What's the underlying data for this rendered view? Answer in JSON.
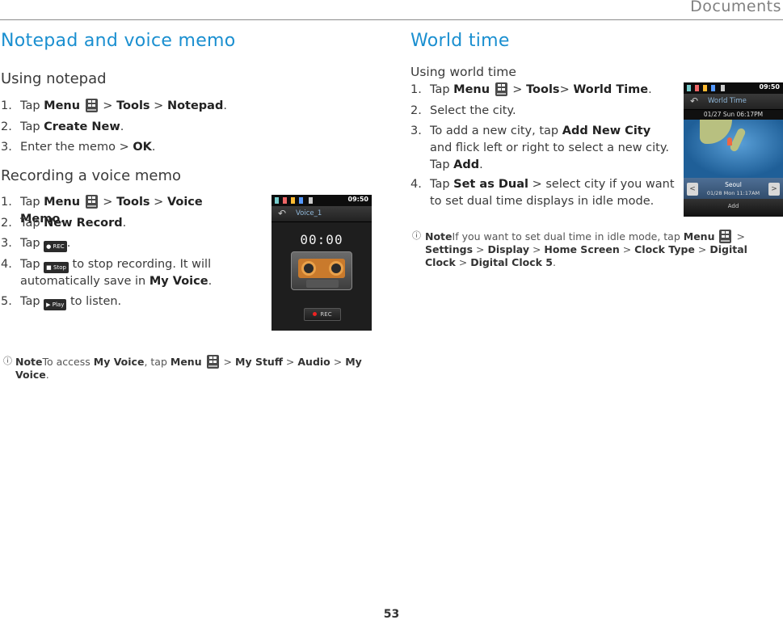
{
  "header": {
    "section": "Documents"
  },
  "left": {
    "title": "Notepad and voice memo",
    "notepad": {
      "heading": "Using notepad",
      "steps": [
        {
          "num": "1.",
          "pre": "Tap ",
          "b1": "Menu",
          "mid1": " > ",
          "b2": "Tools",
          "mid2": " > ",
          "b3": "Notepad",
          "post": "."
        },
        {
          "num": "2.",
          "pre": "Tap ",
          "b1": "Create New",
          "post": "."
        },
        {
          "num": "3.",
          "pre": "Enter the memo > ",
          "b1": "OK",
          "post": "."
        }
      ]
    },
    "voice": {
      "heading": "Recording a voice memo",
      "steps": [
        {
          "num": "1.",
          "pre": "Tap ",
          "b1": "Menu",
          "mid1": " > ",
          "b2": "Tools",
          "mid2": " > ",
          "b3": "Voice Memo",
          "post": "."
        },
        {
          "num": "2.",
          "pre": "Tap ",
          "b1": "New Record",
          "post": "."
        },
        {
          "num": "3.",
          "pre": "Tap ",
          "icon": "REC",
          "post": "."
        },
        {
          "num": "4.",
          "pre": "Tap ",
          "icon": "Stop",
          "post1": " to stop recording. It will automatically save in ",
          "b1": "My Voice",
          "post": "."
        },
        {
          "num": "5.",
          "pre": "Tap ",
          "icon": "Play",
          "post": " to listen."
        }
      ]
    },
    "note": {
      "label": "Note",
      "text1": "To access ",
      "b1": "My Voice",
      "text2": ", tap ",
      "b2": "Menu",
      "text3": " > ",
      "b3": "My Stuff",
      "text4": " > ",
      "b4": "Audio",
      "text5": " > ",
      "b5": "My Voice",
      "text6": "."
    },
    "phone": {
      "clock": "09:50",
      "title": "Voice_1",
      "timer": "00:00",
      "rec": "REC"
    }
  },
  "right": {
    "title": "World time",
    "heading": "Using world time",
    "steps": [
      {
        "num": "1.",
        "pre": "Tap ",
        "b1": "Menu",
        "mid1": " > ",
        "b2": "Tools",
        "mid2": "> ",
        "b3": "World Time",
        "post": "."
      },
      {
        "num": "2.",
        "pre": "Select the city."
      },
      {
        "num": "3.",
        "pre": "To add a new city, tap ",
        "b1": "Add New City",
        "mid1": " and flick left or right to select a new city. Tap ",
        "b2": "Add",
        "post": "."
      },
      {
        "num": "4.",
        "pre": "Tap ",
        "b1": "Set as Dual",
        "post": " > select city if you want to set dual time displays in idle mode."
      }
    ],
    "note": {
      "label": "Note",
      "text1": "If you want to set dual time in idle mode, tap ",
      "b1": "Menu",
      "text2": " > ",
      "b2": "Settings",
      "text3": " > ",
      "b3": "Display",
      "text4": " > ",
      "b4": "Home Screen",
      "text5": " > ",
      "b5": "Clock Type",
      "text6": " > ",
      "b6": "Digital Clock",
      "text7": " > ",
      "b7": "Digital Clock 5",
      "text8": "."
    },
    "phone": {
      "clock": "09:50",
      "title": "World Time",
      "date": "01/27  Sun  06:17PM",
      "city": "Seoul",
      "city_time": "01/28  Mon  11:17AM",
      "add": "Add"
    }
  },
  "footer": {
    "page": "53"
  }
}
